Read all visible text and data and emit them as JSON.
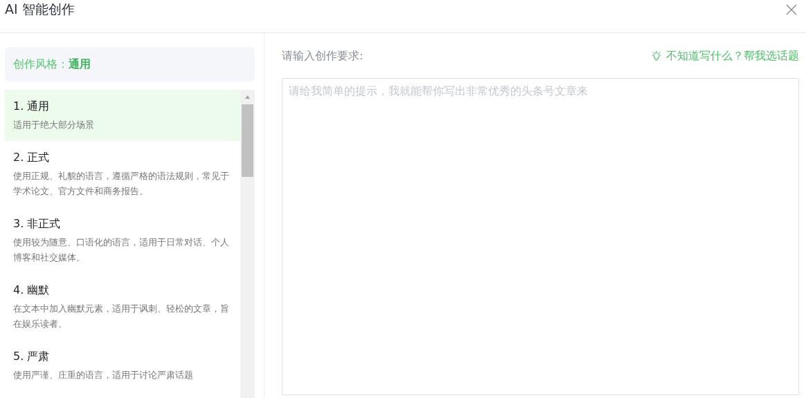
{
  "dialog": {
    "title": "AI 智能创作"
  },
  "style_header": {
    "label": "创作风格：",
    "value": "通用"
  },
  "styles": [
    {
      "title": "1. 通用",
      "description": "适用于绝大部分场景",
      "selected": true
    },
    {
      "title": "2. 正式",
      "description": "使用正规、礼貌的语言，遵循严格的语法规则，常见于学术论文、官方文件和商务报告。",
      "selected": false
    },
    {
      "title": "3. 非正式",
      "description": "使用较为随意、口语化的语言，适用于日常对话、个人博客和社交媒体。",
      "selected": false
    },
    {
      "title": "4. 幽默",
      "description": "在文本中加入幽默元素，适用于讽刺、轻松的文章，旨在娱乐读者。",
      "selected": false
    },
    {
      "title": "5. 严肃",
      "description": "使用严谨、庄重的语言，适用于讨论严肃话题",
      "selected": false
    }
  ],
  "prompt": {
    "label": "请输入创作要求:",
    "suggest_link": "不知道写什么？帮我选话题",
    "placeholder": "请给我简单的提示，我就能帮你写出非常优秀的头条号文章来"
  }
}
